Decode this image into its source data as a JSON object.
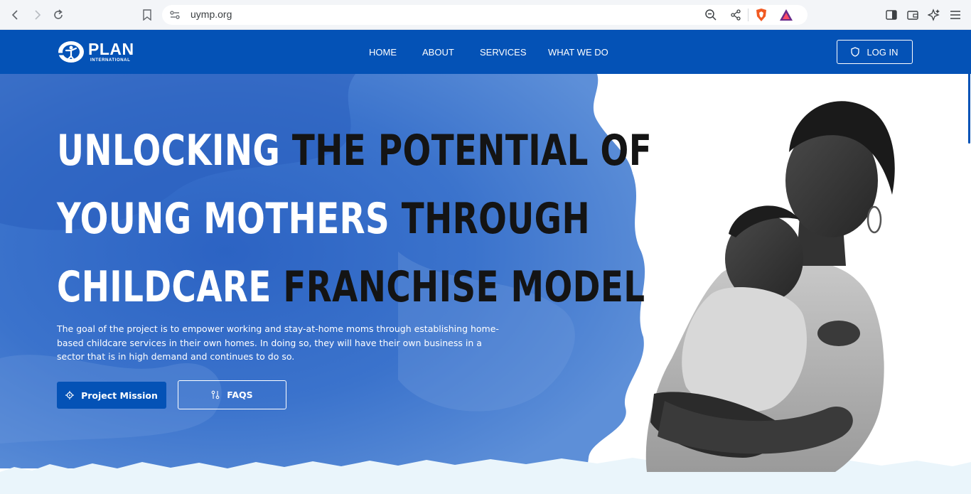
{
  "browser": {
    "url": "uymp.org"
  },
  "header": {
    "logo_word": "PLAN",
    "logo_sub": "INTERNATIONAL",
    "nav": [
      "HOME",
      "ABOUT",
      "SERVICES",
      "WHAT WE DO"
    ],
    "login_label": "LOG IN"
  },
  "hero": {
    "title_lines": [
      {
        "white": "UNLOCKING ",
        "dark": "THE POTENTIAL OF"
      },
      {
        "white": "YOUNG MOTHERS ",
        "dark": "THROUGH"
      },
      {
        "white": "CHILDCARE ",
        "dark": "FRANCHISE MODEL"
      }
    ],
    "description": "The goal of the project is to empower working and stay-at-home moms through establishing home-based childcare services in their own homes. In doing so, they will have their own business in a sector that is in high demand and continues to do so.",
    "primary_button": "Project Mission",
    "secondary_button": "FAQS"
  },
  "colors": {
    "brand_blue": "#0452b6",
    "watercolor_blue": "#3b73cc",
    "footer_tint": "#eaf5fb"
  },
  "icons": [
    "back-icon",
    "forward-icon",
    "reload-icon",
    "bookmark-icon",
    "site-settings-icon",
    "zoom-out-icon",
    "share-icon",
    "brave-shield-icon",
    "rewards-icon",
    "sidebar-icon",
    "wallet-icon",
    "leo-icon",
    "menu-icon",
    "shield-icon",
    "target-icon",
    "faq-icon"
  ]
}
